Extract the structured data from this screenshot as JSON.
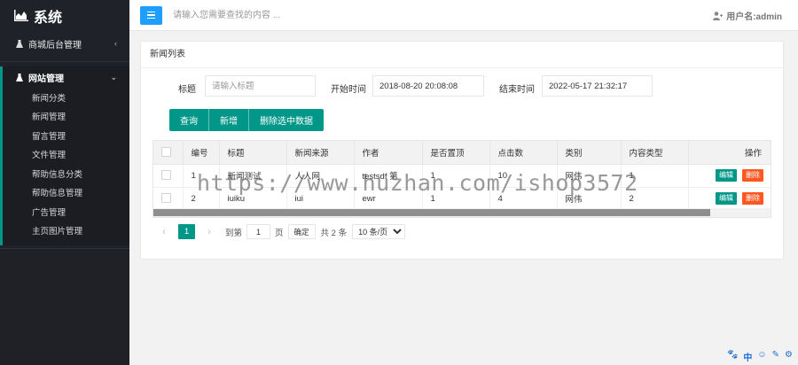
{
  "app": {
    "title": "系统"
  },
  "sidebar": {
    "group_shop": {
      "label": "商城后台管理",
      "chevron": "‹"
    },
    "group_site": {
      "label": "网站管理",
      "chevron": "⌄"
    },
    "items": [
      {
        "label": "新闻分类"
      },
      {
        "label": "新闻管理"
      },
      {
        "label": "留言管理"
      },
      {
        "label": "文件管理"
      },
      {
        "label": "帮助信息分类"
      },
      {
        "label": "帮助信息管理"
      },
      {
        "label": "广告管理"
      },
      {
        "label": "主页图片管理"
      }
    ]
  },
  "header": {
    "search_placeholder": "请输入您需要查找的内容 ...",
    "user_label": "用户名:admin"
  },
  "panel": {
    "title": "新闻列表",
    "filters": {
      "title_label": "标题",
      "title_placeholder": "请输入标题",
      "start_label": "开始时间",
      "start_value": "2018-08-20 20:08:08",
      "end_label": "结束时间",
      "end_value": "2022-05-17 21:32:17"
    },
    "buttons": {
      "query": "查询",
      "add": "新增",
      "delete_selected": "删除选中数据"
    },
    "table": {
      "columns": [
        "编号",
        "标题",
        "新闻来源",
        "作者",
        "是否置顶",
        "点击数",
        "类别",
        "内容类型",
        "操作"
      ],
      "rows": [
        {
          "id": "1",
          "title": "新闻测试",
          "source": "人人网",
          "author": "testsdf 第",
          "top": "1",
          "clicks": "10",
          "category": "网伟",
          "content_type": "1"
        },
        {
          "id": "2",
          "title": "iuiku",
          "source": "iui",
          "author": "ewr",
          "top": "1",
          "clicks": "4",
          "category": "网伟",
          "content_type": "2"
        }
      ],
      "edit_label": "编辑",
      "delete_label": "删除"
    },
    "pager": {
      "prev": "‹",
      "current": "1",
      "next": "›",
      "goto_label": "到第",
      "goto_value": "1",
      "page_unit": "页",
      "confirm": "确定",
      "total": "共 2 条",
      "page_size": "10 条/页"
    }
  },
  "watermark": "https://www.huzhan.com/ishop3572",
  "colors": {
    "accent": "#009688",
    "danger": "#ff5722",
    "menu_button": "#1e9fff",
    "sidebar": "#20222a"
  },
  "bottom_tools": [
    "paw-icon",
    "中",
    "smile-icon",
    "edit-icon",
    "gear-icon"
  ]
}
